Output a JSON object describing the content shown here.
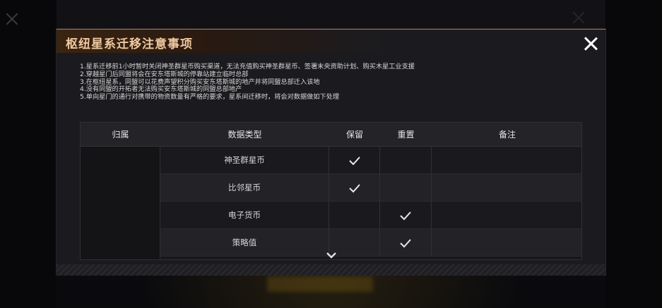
{
  "dialog": {
    "title": "枢纽星系迁移注意事项",
    "notes": [
      "1.星系迁移前1小时暂时关闭神圣群星币购买渠道，无法充值购买神圣群星币、签署末央资助计划、购买木星工业支援",
      "2.穿越星门后同盟将会在安东塔斯城的停靠站建立临时总部",
      "3.在枢纽星系，同盟可以花费声望积分购买安东塔斯城的地产并将同盟总部迁入该地",
      "4.没有同盟的开拓者无法购买安东塔斯城的同盟总部地产",
      "5.单向星门的通行对携带的物资数量有严格的要求，星系间迁移时，将会对数据做如下处理"
    ]
  },
  "table": {
    "headers": [
      "归属",
      "数据类型",
      "保留",
      "重置",
      "备注"
    ],
    "rows": [
      {
        "type": "神圣群星币",
        "keep": true,
        "reset": false,
        "note": ""
      },
      {
        "type": "比邻星币",
        "keep": true,
        "reset": false,
        "note": ""
      },
      {
        "type": "电子货币",
        "keep": false,
        "reset": true,
        "note": ""
      },
      {
        "type": "策略值",
        "keep": false,
        "reset": true,
        "note": ""
      }
    ]
  },
  "icons": {
    "close": "close-icon",
    "check": "check-icon",
    "scroll": "chevron-down-icon"
  },
  "colors": {
    "title": "#f0c9a0",
    "accent": "#c66a22",
    "check": "#e8e8e8"
  }
}
